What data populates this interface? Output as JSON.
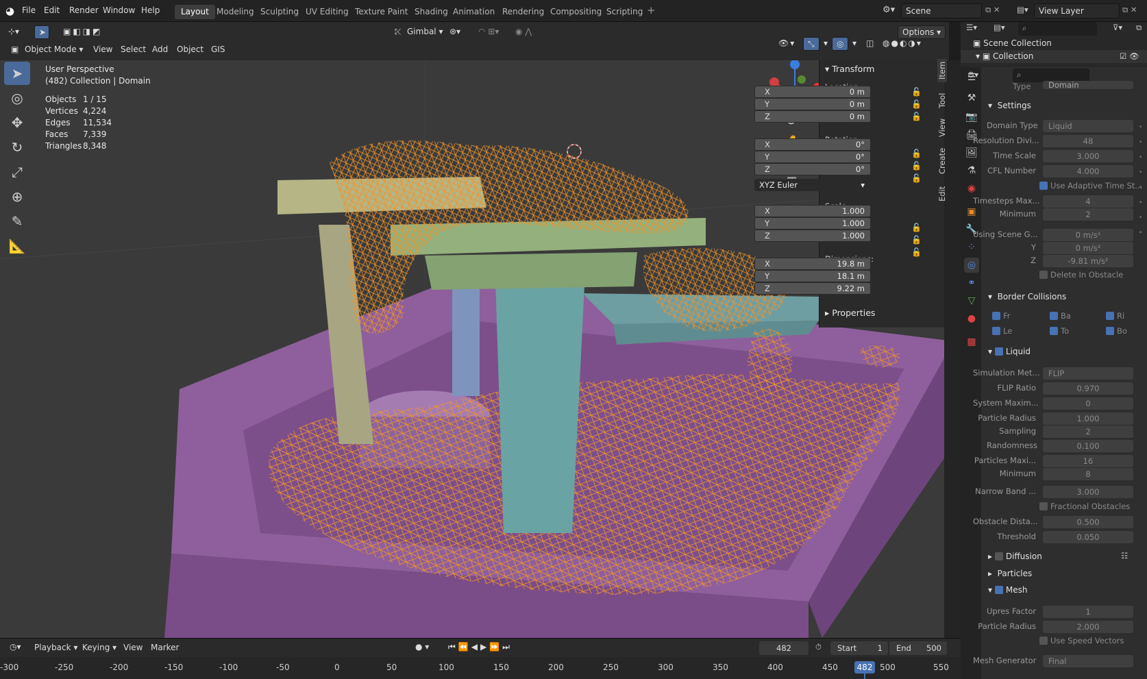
{
  "topbar": {
    "menus": [
      "File",
      "Edit",
      "Render",
      "Window",
      "Help"
    ],
    "workspaces": [
      "Layout",
      "Modeling",
      "Sculpting",
      "UV Editing",
      "Texture Paint",
      "Shading",
      "Animation",
      "Rendering",
      "Compositing",
      "Scripting"
    ],
    "active_workspace": "Layout",
    "scene": "Scene",
    "view_layer": "View Layer"
  },
  "viewport_header": {
    "orientation": "Gimbal",
    "options": "Options",
    "mode": "Object Mode",
    "menus": [
      "View",
      "Select",
      "Add",
      "Object",
      "GIS"
    ]
  },
  "overlay": {
    "view_name": "User Perspective",
    "collection_line": "(482) Collection | Domain",
    "stats": [
      {
        "label": "Objects",
        "value": "1 / 15"
      },
      {
        "label": "Vertices",
        "value": "4,224"
      },
      {
        "label": "Edges",
        "value": "11,534"
      },
      {
        "label": "Faces",
        "value": "7,339"
      },
      {
        "label": "Triangles",
        "value": "8,348"
      }
    ]
  },
  "npanel": {
    "transform_title": "Transform",
    "location_label": "Location:",
    "location": [
      {
        "axis": "X",
        "value": "0 m"
      },
      {
        "axis": "Y",
        "value": "0 m"
      },
      {
        "axis": "Z",
        "value": "0 m"
      }
    ],
    "rotation_label": "Rotation:",
    "rotation": [
      {
        "axis": "X",
        "value": "0°"
      },
      {
        "axis": "Y",
        "value": "0°"
      },
      {
        "axis": "Z",
        "value": "0°"
      }
    ],
    "rotation_mode": "XYZ Euler",
    "scale_label": "Scale:",
    "scale": [
      {
        "axis": "X",
        "value": "1.000"
      },
      {
        "axis": "Y",
        "value": "1.000"
      },
      {
        "axis": "Z",
        "value": "1.000"
      }
    ],
    "dimensions_label": "Dimensions:",
    "dimensions": [
      {
        "axis": "X",
        "value": "19.8 m"
      },
      {
        "axis": "Y",
        "value": "18.1 m"
      },
      {
        "axis": "Z",
        "value": "9.22 m"
      }
    ],
    "properties_title": "Properties",
    "tabs": [
      "Item",
      "Tool",
      "View",
      "Create",
      "Edit"
    ]
  },
  "outliner": {
    "scene_collection": "Scene Collection",
    "collection": "Collection"
  },
  "properties": {
    "type_label": "Type",
    "type_value": "Domain",
    "settings": "Settings",
    "rows1": [
      {
        "label": "Domain Type",
        "value": "Liquid",
        "kind": "dropdown"
      },
      {
        "label": "Resolution Divi...",
        "value": "48"
      },
      {
        "label": "Time Scale",
        "value": "3.000"
      },
      {
        "label": "CFL Number",
        "value": "4.000"
      }
    ],
    "adaptive": "Use Adaptive Time St...",
    "rows2": [
      {
        "label": "Timesteps Max...",
        "value": "4"
      },
      {
        "label": "Minimum",
        "value": "2"
      },
      {
        "label": "Using Scene G...",
        "value": "0 m/s²"
      },
      {
        "label": "Y",
        "value": "0 m/s²"
      },
      {
        "label": "Z",
        "value": "-9.81 m/s²"
      }
    ],
    "delete_obstacle": "Delete In Obstacle",
    "border_collisions": "Border Collisions",
    "borders": [
      "Fr",
      "Ba",
      "Ri",
      "Le",
      "To",
      "Bo"
    ],
    "liquid": "Liquid",
    "rows3": [
      {
        "label": "Simulation Met...",
        "value": "FLIP",
        "kind": "dropdown"
      },
      {
        "label": "FLIP Ratio",
        "value": "0.970"
      },
      {
        "label": "System Maxim...",
        "value": "0"
      },
      {
        "label": "Particle Radius",
        "value": "1.000"
      },
      {
        "label": "Sampling",
        "value": "2"
      },
      {
        "label": "Randomness",
        "value": "0.100"
      },
      {
        "label": "Particles Maxi...",
        "value": "16"
      },
      {
        "label": "Minimum",
        "value": "8"
      },
      {
        "label": "Narrow Band ...",
        "value": "3.000"
      }
    ],
    "fractional": "Fractional Obstacles",
    "rows4": [
      {
        "label": "Obstacle Dista...",
        "value": "0.500"
      },
      {
        "label": "Threshold",
        "value": "0.050"
      }
    ],
    "diffusion": "Diffusion",
    "particles": "Particles",
    "mesh": "Mesh",
    "rows5": [
      {
        "label": "Upres Factor",
        "value": "1"
      },
      {
        "label": "Particle Radius",
        "value": "2.000"
      }
    ],
    "speed_vectors": "Use Speed Vectors",
    "mesh_generator_label": "Mesh Generator",
    "mesh_generator_value": "Final"
  },
  "timeline": {
    "menus": [
      "Playback",
      "Keying",
      "View",
      "Marker"
    ],
    "current_frame": "482",
    "start_label": "Start",
    "start": "1",
    "end_label": "End",
    "end": "500",
    "ticks": [
      "-300",
      "-250",
      "-200",
      "-150",
      "-100",
      "-50",
      "0",
      "50",
      "100",
      "150",
      "200",
      "250",
      "300",
      "350",
      "400",
      "450",
      "500",
      "550"
    ],
    "playhead": "482"
  },
  "colors": {
    "accent": "#4772b3",
    "wire": "#f0922a",
    "base": "#9b6da8",
    "green": "#94b07c",
    "teal": "#6aa3a3"
  }
}
